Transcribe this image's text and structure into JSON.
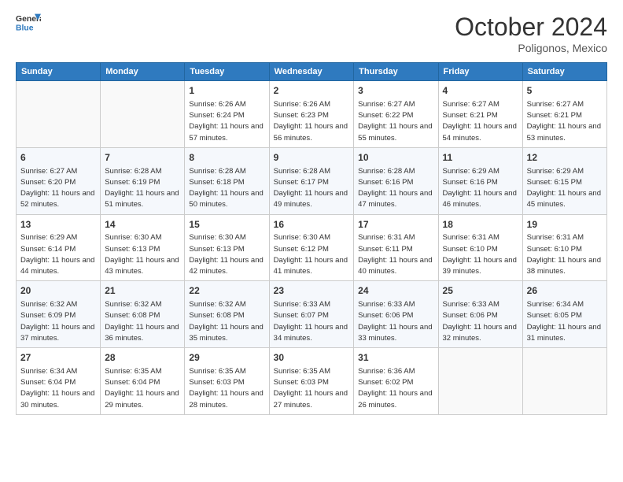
{
  "header": {
    "logo_line1": "General",
    "logo_line2": "Blue",
    "month": "October 2024",
    "location": "Poligonos, Mexico"
  },
  "weekdays": [
    "Sunday",
    "Monday",
    "Tuesday",
    "Wednesday",
    "Thursday",
    "Friday",
    "Saturday"
  ],
  "weeks": [
    [
      {
        "day": "",
        "info": ""
      },
      {
        "day": "",
        "info": ""
      },
      {
        "day": "1",
        "info": "Sunrise: 6:26 AM\nSunset: 6:24 PM\nDaylight: 11 hours and 57 minutes."
      },
      {
        "day": "2",
        "info": "Sunrise: 6:26 AM\nSunset: 6:23 PM\nDaylight: 11 hours and 56 minutes."
      },
      {
        "day": "3",
        "info": "Sunrise: 6:27 AM\nSunset: 6:22 PM\nDaylight: 11 hours and 55 minutes."
      },
      {
        "day": "4",
        "info": "Sunrise: 6:27 AM\nSunset: 6:21 PM\nDaylight: 11 hours and 54 minutes."
      },
      {
        "day": "5",
        "info": "Sunrise: 6:27 AM\nSunset: 6:21 PM\nDaylight: 11 hours and 53 minutes."
      }
    ],
    [
      {
        "day": "6",
        "info": "Sunrise: 6:27 AM\nSunset: 6:20 PM\nDaylight: 11 hours and 52 minutes."
      },
      {
        "day": "7",
        "info": "Sunrise: 6:28 AM\nSunset: 6:19 PM\nDaylight: 11 hours and 51 minutes."
      },
      {
        "day": "8",
        "info": "Sunrise: 6:28 AM\nSunset: 6:18 PM\nDaylight: 11 hours and 50 minutes."
      },
      {
        "day": "9",
        "info": "Sunrise: 6:28 AM\nSunset: 6:17 PM\nDaylight: 11 hours and 49 minutes."
      },
      {
        "day": "10",
        "info": "Sunrise: 6:28 AM\nSunset: 6:16 PM\nDaylight: 11 hours and 47 minutes."
      },
      {
        "day": "11",
        "info": "Sunrise: 6:29 AM\nSunset: 6:16 PM\nDaylight: 11 hours and 46 minutes."
      },
      {
        "day": "12",
        "info": "Sunrise: 6:29 AM\nSunset: 6:15 PM\nDaylight: 11 hours and 45 minutes."
      }
    ],
    [
      {
        "day": "13",
        "info": "Sunrise: 6:29 AM\nSunset: 6:14 PM\nDaylight: 11 hours and 44 minutes."
      },
      {
        "day": "14",
        "info": "Sunrise: 6:30 AM\nSunset: 6:13 PM\nDaylight: 11 hours and 43 minutes."
      },
      {
        "day": "15",
        "info": "Sunrise: 6:30 AM\nSunset: 6:13 PM\nDaylight: 11 hours and 42 minutes."
      },
      {
        "day": "16",
        "info": "Sunrise: 6:30 AM\nSunset: 6:12 PM\nDaylight: 11 hours and 41 minutes."
      },
      {
        "day": "17",
        "info": "Sunrise: 6:31 AM\nSunset: 6:11 PM\nDaylight: 11 hours and 40 minutes."
      },
      {
        "day": "18",
        "info": "Sunrise: 6:31 AM\nSunset: 6:10 PM\nDaylight: 11 hours and 39 minutes."
      },
      {
        "day": "19",
        "info": "Sunrise: 6:31 AM\nSunset: 6:10 PM\nDaylight: 11 hours and 38 minutes."
      }
    ],
    [
      {
        "day": "20",
        "info": "Sunrise: 6:32 AM\nSunset: 6:09 PM\nDaylight: 11 hours and 37 minutes."
      },
      {
        "day": "21",
        "info": "Sunrise: 6:32 AM\nSunset: 6:08 PM\nDaylight: 11 hours and 36 minutes."
      },
      {
        "day": "22",
        "info": "Sunrise: 6:32 AM\nSunset: 6:08 PM\nDaylight: 11 hours and 35 minutes."
      },
      {
        "day": "23",
        "info": "Sunrise: 6:33 AM\nSunset: 6:07 PM\nDaylight: 11 hours and 34 minutes."
      },
      {
        "day": "24",
        "info": "Sunrise: 6:33 AM\nSunset: 6:06 PM\nDaylight: 11 hours and 33 minutes."
      },
      {
        "day": "25",
        "info": "Sunrise: 6:33 AM\nSunset: 6:06 PM\nDaylight: 11 hours and 32 minutes."
      },
      {
        "day": "26",
        "info": "Sunrise: 6:34 AM\nSunset: 6:05 PM\nDaylight: 11 hours and 31 minutes."
      }
    ],
    [
      {
        "day": "27",
        "info": "Sunrise: 6:34 AM\nSunset: 6:04 PM\nDaylight: 11 hours and 30 minutes."
      },
      {
        "day": "28",
        "info": "Sunrise: 6:35 AM\nSunset: 6:04 PM\nDaylight: 11 hours and 29 minutes."
      },
      {
        "day": "29",
        "info": "Sunrise: 6:35 AM\nSunset: 6:03 PM\nDaylight: 11 hours and 28 minutes."
      },
      {
        "day": "30",
        "info": "Sunrise: 6:35 AM\nSunset: 6:03 PM\nDaylight: 11 hours and 27 minutes."
      },
      {
        "day": "31",
        "info": "Sunrise: 6:36 AM\nSunset: 6:02 PM\nDaylight: 11 hours and 26 minutes."
      },
      {
        "day": "",
        "info": ""
      },
      {
        "day": "",
        "info": ""
      }
    ]
  ]
}
